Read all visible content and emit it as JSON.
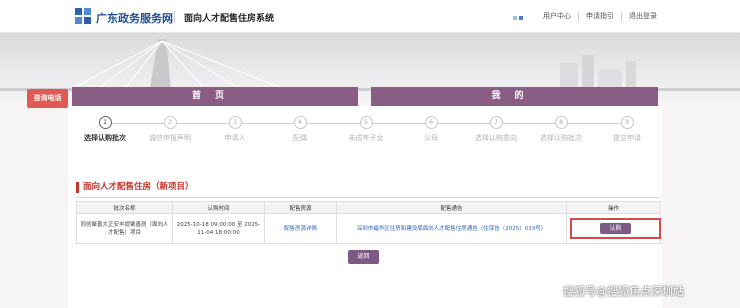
{
  "header": {
    "site_name": "广东政务服务网",
    "system_name": "面向人才配售住房系统",
    "links": [
      "用户中心",
      "申请指引",
      "退出登录"
    ]
  },
  "hotline": "咨询电话",
  "nav": {
    "home": "首页",
    "mine": "我的"
  },
  "steps": [
    {
      "num": "1",
      "label": "选择认购批次",
      "active": true
    },
    {
      "num": "2",
      "label": "诚信申报声明",
      "active": false
    },
    {
      "num": "3",
      "label": "申请人",
      "active": false
    },
    {
      "num": "4",
      "label": "配偶",
      "active": false
    },
    {
      "num": "5",
      "label": "未成年子女",
      "active": false
    },
    {
      "num": "6",
      "label": "父母",
      "active": false
    },
    {
      "num": "7",
      "label": "选择认购意向",
      "active": false
    },
    {
      "num": "8",
      "label": "选择认购批次",
      "active": false
    },
    {
      "num": "9",
      "label": "提交申请",
      "active": false
    }
  ],
  "section_title": "面向人才配售住房（新项目）",
  "table": {
    "headers": [
      "批次名称",
      "认购时间",
      "配售房源",
      "配售通告",
      "操作"
    ],
    "rows": [
      {
        "batch": "同创聚善大正安丰提聚善居（面向人才配售）项目",
        "time": "2025-10-18 09:00:00 至 2025-11-04 18:00:00",
        "housing": "配售房源详情",
        "notice": "深圳市福华区住房和建设局面向人才配售住房通告（住保告〔2025〕033号）",
        "action": "认购"
      }
    ]
  },
  "back_button": "返回",
  "watermark": "搜狐号@搜狐焦点深圳站"
}
